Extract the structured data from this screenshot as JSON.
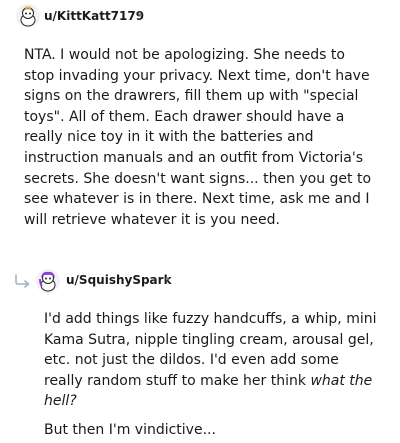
{
  "comments": [
    {
      "username": "u/KittKatt7179",
      "separator": "•",
      "avatar_icon": "snoo-avatar-icon",
      "paragraphs": [
        "NTA. I would not be apologizing. She needs to stop invading your privacy. Next time, don't have signs on the drawrers, fill them up with \"special toys\". All of them. Each drawer should have a really nice toy in it with the batteries and instruction manuals and an outfit from Victoria's secrets. She doesn't want signs... then you get to see whatever is in there. Next time, ask me and I will retrieve whatever it is you need."
      ]
    },
    {
      "username": "u/SquishySpark",
      "separator": "•",
      "avatar_icon": "snoo-avatar-icon",
      "reply_icon": "reply-arrow-icon",
      "paragraph1_plain": "I'd add things like fuzzy handcuffs, a whip, mini Kama Sutra, nipple tingling cream, arousal gel, etc. not just the dildos. I'd even add some really random stuff to make her think ",
      "paragraph1_italic": "what the hell?",
      "paragraph2": "But then I'm vindictive..."
    }
  ],
  "colors": {
    "text": "#1a1a1b",
    "meta": "#7c7c7c",
    "reply_arrow": "#9fb3c8"
  }
}
